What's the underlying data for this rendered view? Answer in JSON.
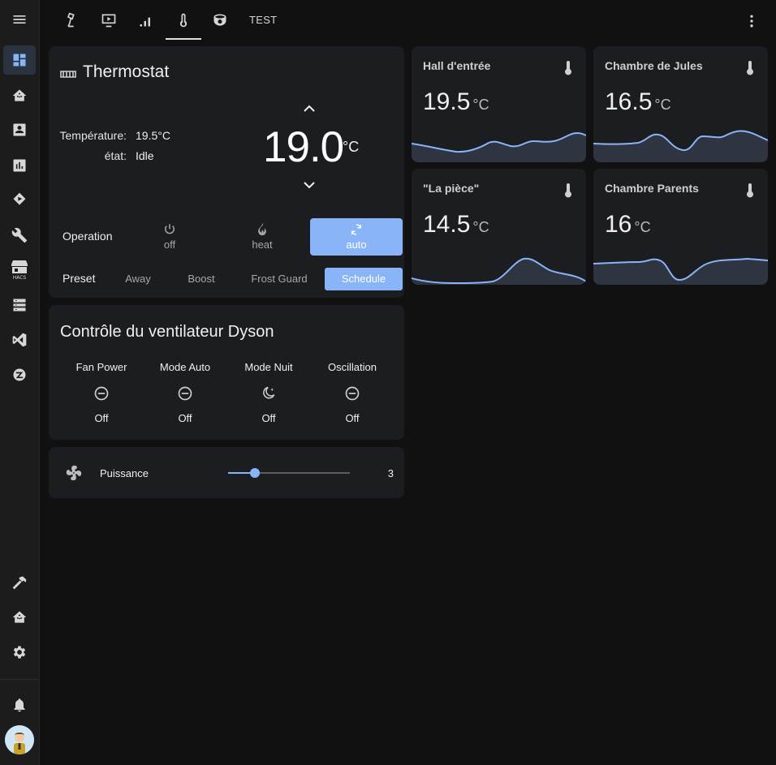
{
  "topbar": {
    "tabs": [
      {
        "icon": "desk-lamp-icon"
      },
      {
        "icon": "monitor-play-icon"
      },
      {
        "icon": "signal-bars-icon"
      },
      {
        "icon": "thermometer-icon"
      },
      {
        "icon": "robot-vacuum-icon"
      }
    ],
    "active_tab": 3,
    "text_tab": "TEST"
  },
  "sidebar": {
    "items": [
      {
        "icon": "dashboard-icon"
      },
      {
        "icon": "home-assistant-icon"
      },
      {
        "icon": "account-box-icon"
      },
      {
        "icon": "chart-box-icon"
      },
      {
        "icon": "media-icon"
      },
      {
        "icon": "wrench-icon"
      },
      {
        "icon": "hacs-store-icon",
        "label": "HACS"
      },
      {
        "icon": "server-icon"
      },
      {
        "icon": "vscode-icon"
      },
      {
        "icon": "zigbee-icon"
      }
    ],
    "bottom_items": [
      {
        "icon": "hammer-icon"
      },
      {
        "icon": "home-assistant-icon"
      },
      {
        "icon": "cog-icon"
      }
    ]
  },
  "thermostat": {
    "title": "Thermostat",
    "temperature_label": "Température:",
    "temperature_value": "19.5°C",
    "state_label": "état:",
    "state_value": "Idle",
    "setpoint": "19.0",
    "setpoint_unit": "°C",
    "operation_label": "Operation",
    "operations": [
      {
        "label": "off",
        "icon": "power-icon",
        "active": false
      },
      {
        "label": "heat",
        "icon": "fire-icon",
        "active": false
      },
      {
        "label": "auto",
        "icon": "refresh-icon",
        "active": true
      }
    ],
    "preset_label": "Preset",
    "presets": [
      {
        "label": "Away",
        "active": false
      },
      {
        "label": "Boost",
        "active": false
      },
      {
        "label": "Frost Guard",
        "active": false
      },
      {
        "label": "Schedule",
        "active": true
      }
    ]
  },
  "dyson": {
    "title": "Contrôle du ventilateur Dyson",
    "controls": [
      {
        "name": "Fan Power",
        "state": "Off",
        "icon": "minus-circle-icon"
      },
      {
        "name": "Mode Auto",
        "state": "Off",
        "icon": "minus-circle-icon"
      },
      {
        "name": "Mode Nuit",
        "state": "Off",
        "icon": "moon-star-icon"
      },
      {
        "name": "Oscillation",
        "state": "Off",
        "icon": "minus-circle-icon"
      }
    ]
  },
  "puissance": {
    "label": "Puissance",
    "value": "3",
    "fraction": 0.22
  },
  "sensors": [
    {
      "name": "Hall d'entrée",
      "value": "19.5",
      "unit": "°C"
    },
    {
      "name": "Chambre de Jules",
      "value": "16.5",
      "unit": "°C"
    },
    {
      "name": "\"La pièce\"",
      "value": "14.5",
      "unit": "°C"
    },
    {
      "name": "Chambre Parents",
      "value": "16",
      "unit": "°C"
    }
  ],
  "colors": {
    "accent": "#8ab4f8",
    "card": "#1c1d21",
    "background": "#111111"
  }
}
